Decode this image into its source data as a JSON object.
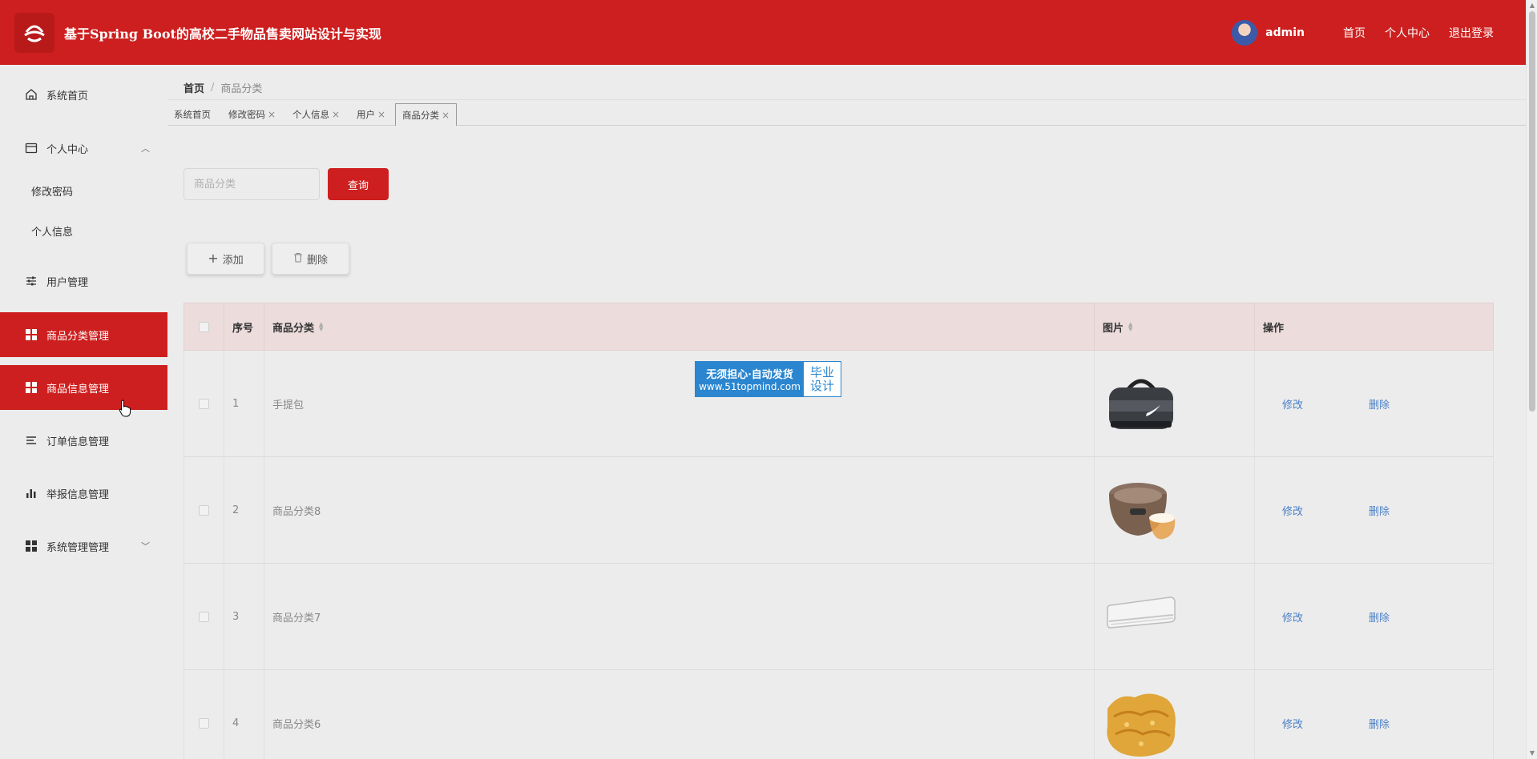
{
  "header": {
    "title": "基于Spring Boot的高校二手物品售卖网站设计与实现",
    "user": "admin",
    "links": [
      "首页",
      "个人中心",
      "退出登录"
    ],
    "accent": "#cd1f1f"
  },
  "sidebar": {
    "items": [
      {
        "label": "系统首页",
        "icon": "home-icon"
      },
      {
        "label": "个人中心",
        "icon": "card-icon"
      },
      {
        "label": "修改密码"
      },
      {
        "label": "个人信息"
      },
      {
        "label": "用户管理",
        "icon": "sliders-icon"
      },
      {
        "label": "商品分类管理",
        "icon": "grid-icon"
      },
      {
        "label": "商品信息管理",
        "icon": "grid-icon"
      },
      {
        "label": "订单信息管理",
        "icon": "list-icon"
      },
      {
        "label": "举报信息管理",
        "icon": "bar-chart-icon"
      },
      {
        "label": "系统管理管理",
        "icon": "grid-icon"
      }
    ]
  },
  "breadcrumb": {
    "home": "首页",
    "sep": "/",
    "current": "商品分类"
  },
  "tags": [
    "系统首页",
    "修改密码",
    "个人信息",
    "用户",
    "商品分类"
  ],
  "tag_close": "×",
  "search": {
    "placeholder": "商品分类",
    "button": "查询"
  },
  "toolbar": {
    "add": "添加",
    "delete": "删除"
  },
  "table": {
    "headers": {
      "index": "序号",
      "category": "商品分类",
      "image": "图片",
      "ops": "操作"
    },
    "edit": "修改",
    "remove": "删除",
    "rows": [
      {
        "index": "1",
        "name": "手提包",
        "image": "bag-image"
      },
      {
        "index": "2",
        "name": "商品分类8",
        "image": "rice-cooker-image"
      },
      {
        "index": "3",
        "name": "商品分类7",
        "image": "air-conditioner-image"
      },
      {
        "index": "4",
        "name": "商品分类6",
        "image": "food-image"
      }
    ]
  },
  "watermark": {
    "line1": "无须担心·自动发货",
    "line2": "www.51topmind.com",
    "right1": "毕业",
    "right2": "设计"
  }
}
